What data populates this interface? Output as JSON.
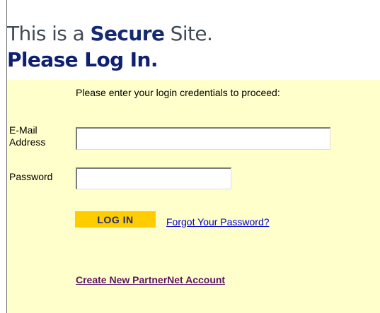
{
  "header": {
    "prefix": "This is a ",
    "secure_word": "Secure",
    "suffix": " Site.",
    "line2": "Please Log In."
  },
  "form": {
    "instructions": "Please enter your login credentials to proceed:",
    "email_label": "E-Mail Address",
    "email_value": "",
    "password_label": "Password",
    "password_value": "",
    "login_button": "LOG IN",
    "forgot_link": "Forgot Your Password?",
    "create_account_link": "Create New PartnerNet Account"
  },
  "colors": {
    "panel_background": "#ffffcc",
    "button_background": "#ffcc00",
    "heading_navy": "#0f2070",
    "link_blue": "#0000cc",
    "link_purple": "#5b1466"
  }
}
